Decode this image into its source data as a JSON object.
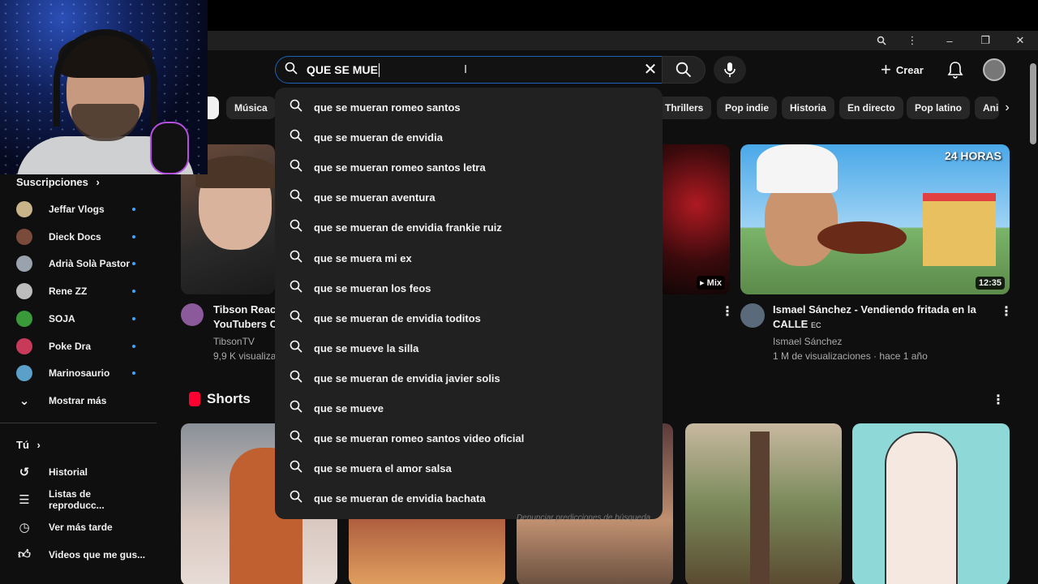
{
  "search": {
    "query": "QUE SE MUE",
    "suggestions": [
      "que se mueran romeo santos",
      "que se mueran de envidia",
      "que se mueran romeo santos letra",
      "que se mueran aventura",
      "que se mueran de envidia frankie ruiz",
      "que se muera mi ex",
      "que se mueran los feos",
      "que se mueran de envidia toditos",
      "que se mueve la silla",
      "que se mueran de envidia javier solis",
      "que se mueve",
      "que se mueran romeo santos video oficial",
      "que se muera el amor salsa",
      "que se mueran de envidia bachata"
    ],
    "report_text": "Denunciar predicciones de búsqueda"
  },
  "masthead": {
    "create_label": "Crear"
  },
  "chips": [
    "Música",
    "Thrillers",
    "Pop indie",
    "Historia",
    "En directo",
    "Pop latino",
    "Ani"
  ],
  "sidebar": {
    "subscriptions_title": "Suscripciones",
    "subscriptions": [
      {
        "name": "Jeffar Vlogs",
        "color": "#c9b48a"
      },
      {
        "name": "Dieck Docs",
        "color": "#7a4a3a"
      },
      {
        "name": "Adrià Solà Pastor",
        "color": "#9aa3ad"
      },
      {
        "name": "Rene ZZ",
        "color": "#bdbdbd"
      },
      {
        "name": "SOJA",
        "color": "#3a9a3a"
      },
      {
        "name": "Poke Dra",
        "color": "#c83a5a"
      },
      {
        "name": "Marinosaurio",
        "color": "#5aa0c8"
      }
    ],
    "show_more": "Mostrar más",
    "you_title": "Tú",
    "you_items": [
      {
        "label": "Historial",
        "icon": "history-icon"
      },
      {
        "label": "Listas de reproducc...",
        "icon": "playlist-icon"
      },
      {
        "label": "Ver más tarde",
        "icon": "clock-icon"
      },
      {
        "label": "Videos que me gus...",
        "icon": "thumbs-up-icon"
      }
    ]
  },
  "videos": [
    {
      "title_line1": "Tibson Reac",
      "title_line2": "YouTubers C",
      "channel": "TibsonTV",
      "meta": "9,9 K visualiza"
    },
    {
      "badge": "Mix"
    },
    {
      "title_line1": "Ismael Sánchez - Vendiendo fritada en la",
      "title_line2": "CALLE",
      "flag": "EC",
      "channel": "Ismael Sánchez",
      "meta": "1 M de visualizaciones · hace 1 año",
      "duration": "12:35",
      "thumb_text": "24 HORAS"
    }
  ],
  "shorts_title": "Shorts",
  "colors": {
    "background": "#0f0f0f",
    "focus_blue": "#1c62b9",
    "dropdown": "#212121",
    "chip": "#272727",
    "dot_blue": "#3ea6ff"
  }
}
